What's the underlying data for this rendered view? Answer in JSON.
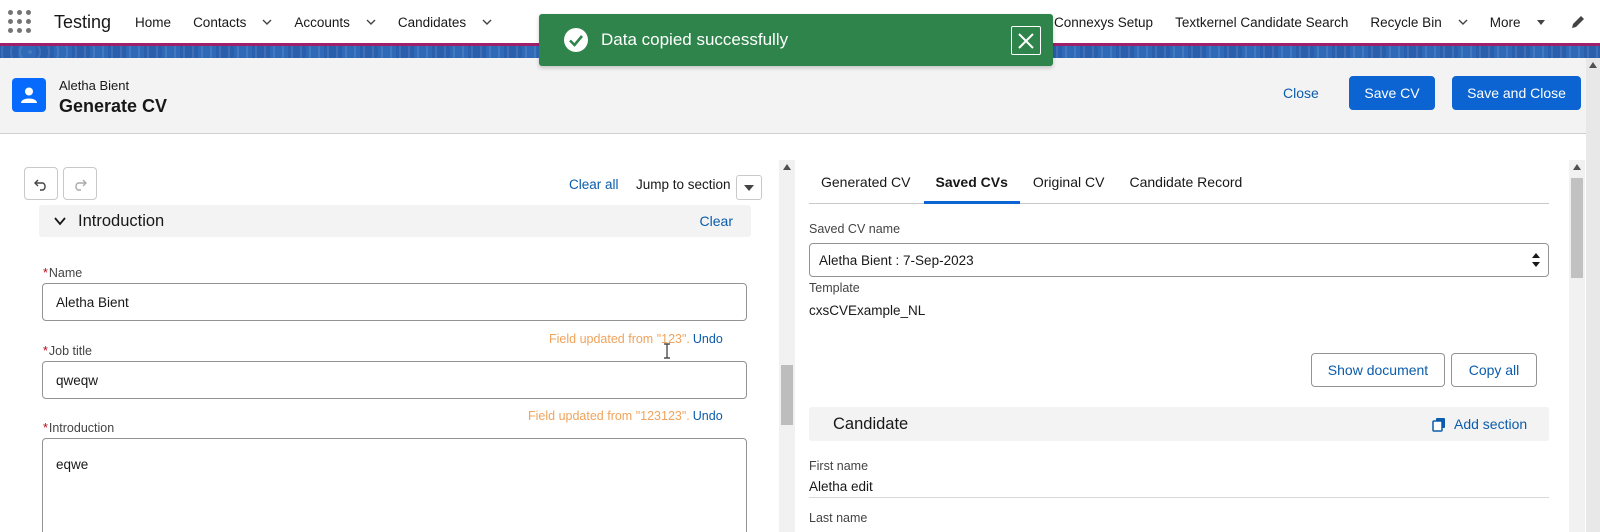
{
  "nav": {
    "app_name": "Testing",
    "items": [
      {
        "label": "Home",
        "has_menu": false
      },
      {
        "label": "Contacts",
        "has_menu": true
      },
      {
        "label": "Accounts",
        "has_menu": true
      },
      {
        "label": "Candidates",
        "has_menu": true
      }
    ],
    "right_items": [
      {
        "label": "Connexys Setup",
        "has_menu": false
      },
      {
        "label": "Textkernel Candidate Search",
        "has_menu": false
      },
      {
        "label": "Recycle Bin",
        "has_menu": true
      },
      {
        "label": "More",
        "has_menu": true
      }
    ]
  },
  "toast": {
    "message": "Data copied successfully",
    "variant": "success",
    "color": "#2e844a"
  },
  "header": {
    "record_name": "Aletha Bient",
    "title": "Generate CV",
    "close_label": "Close",
    "save_cv_label": "Save CV",
    "save_close_label": "Save and Close",
    "brand_color": "#0b64d1"
  },
  "left_panel": {
    "clear_all_label": "Clear all",
    "jump_label": "Jump to section",
    "section": {
      "title": "Introduction",
      "clear_label": "Clear"
    },
    "fields": {
      "name": {
        "label": "Name",
        "value": "Aletha Bient"
      },
      "job_title": {
        "label": "Job title",
        "value": "qweqw",
        "update_note": "Field updated from \"123\".",
        "undo_label": "Undo"
      },
      "introduction": {
        "label": "Introduction",
        "value": "eqwe",
        "update_note": "Field updated from \"123123\".",
        "undo_label": "Undo"
      }
    }
  },
  "right_panel": {
    "tabs": [
      {
        "label": "Generated CV",
        "active": false
      },
      {
        "label": "Saved CVs",
        "active": true
      },
      {
        "label": "Original CV",
        "active": false
      },
      {
        "label": "Candidate Record",
        "active": false
      }
    ],
    "saved_cv_name_label": "Saved CV name",
    "saved_cv_name_value": "Aletha Bient : 7-Sep-2023",
    "template_label": "Template",
    "template_value": "cxsCVExample_NL",
    "show_document_label": "Show document",
    "copy_all_label": "Copy all",
    "section_title": "Candidate",
    "add_section_label": "Add section",
    "first_name_label": "First name",
    "first_name_value": "Aletha edit",
    "last_name_label": "Last name"
  }
}
